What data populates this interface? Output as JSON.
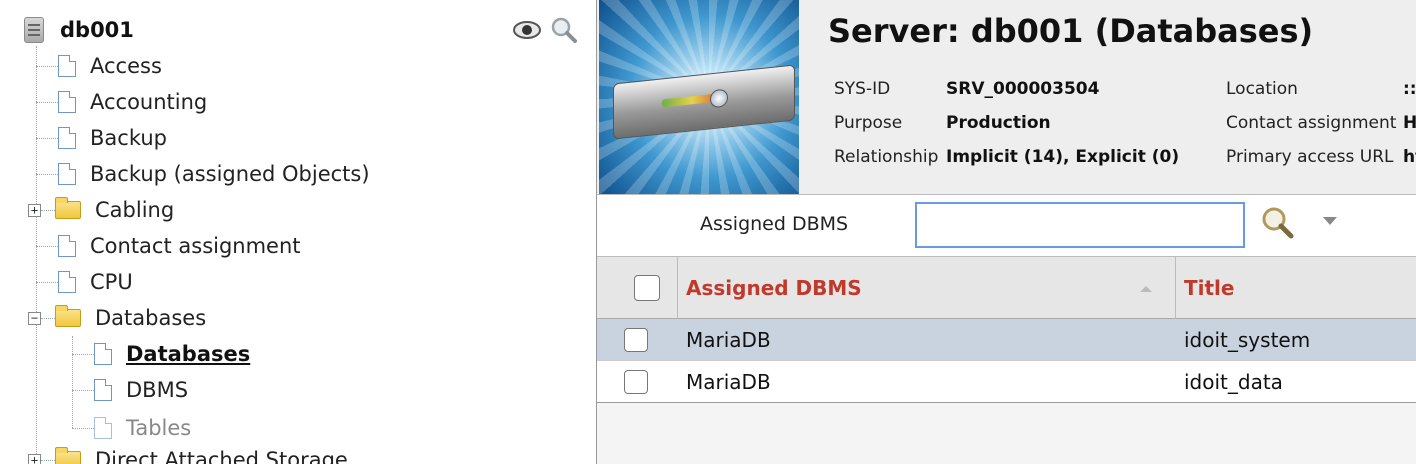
{
  "tree": {
    "root_label": "db001",
    "items": [
      {
        "label": "Access",
        "type": "doc"
      },
      {
        "label": "Accounting",
        "type": "doc"
      },
      {
        "label": "Backup",
        "type": "doc"
      },
      {
        "label": "Backup (assigned Objects)",
        "type": "doc"
      },
      {
        "label": "Cabling",
        "type": "folder",
        "toggle": "+"
      },
      {
        "label": "Contact assignment",
        "type": "doc"
      },
      {
        "label": "CPU",
        "type": "doc"
      },
      {
        "label": "Databases",
        "type": "folder",
        "toggle": "−"
      },
      {
        "label": "Databases",
        "type": "doc",
        "child": true,
        "state": "active"
      },
      {
        "label": "DBMS",
        "type": "doc",
        "child": true
      },
      {
        "label": "Tables",
        "type": "doc",
        "child": true,
        "state": "disabled"
      },
      {
        "label": "Direct Attached Storage",
        "type": "folder",
        "toggle": "+"
      }
    ],
    "icons": [
      "eye-icon",
      "magnifier-icon"
    ]
  },
  "header": {
    "title": "Server: db001 (Databases)",
    "fields": [
      {
        "key": "SYS-ID",
        "value": "SRV_000003504"
      },
      {
        "key": "Purpose",
        "value": "Production"
      },
      {
        "key": "Relationship",
        "value": "Implicit (14), Explicit (0)"
      },
      {
        "key": "Location",
        "value": "::"
      },
      {
        "key": "Contact assignment",
        "value": "H"
      },
      {
        "key": "Primary access URL",
        "value": "ht"
      }
    ]
  },
  "filter": {
    "label": "Assigned DBMS",
    "value": "",
    "placeholder": ""
  },
  "table": {
    "columns": [
      "Assigned DBMS",
      "Title"
    ],
    "rows": [
      {
        "dbms": "MariaDB",
        "title": "idoit_system",
        "selected": true
      },
      {
        "dbms": "MariaDB",
        "title": "idoit_data",
        "selected": false
      }
    ]
  },
  "colors": {
    "header_link": "#c0392b",
    "selected_row": "#c9d3df",
    "input_border": "#6a9ae0"
  }
}
